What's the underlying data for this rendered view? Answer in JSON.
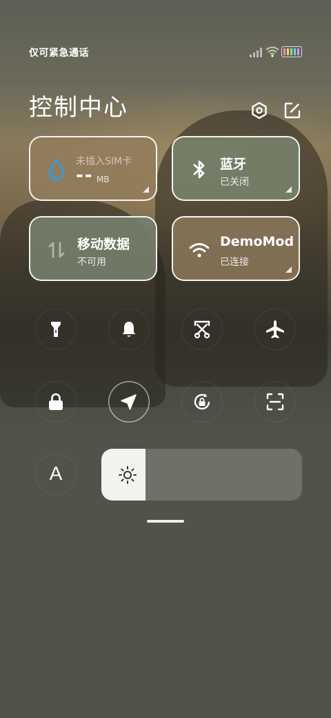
{
  "status_bar": {
    "carrier": "仅可紧急通话"
  },
  "header": {
    "title": "控制中心"
  },
  "tiles": {
    "data_usage": {
      "title": "未插入SIM卡",
      "value": "--",
      "unit": "MB"
    },
    "bluetooth": {
      "title": "蓝牙",
      "status": "已关闭"
    },
    "mobile_data": {
      "title": "移动数据",
      "status": "不可用"
    },
    "wifi": {
      "title": "DemoMod",
      "status": "已连接"
    }
  },
  "auto_brightness": {
    "label": "A"
  },
  "brightness": {
    "level": 0.22
  },
  "colors": {
    "tile_brown": "#8f7c5f",
    "tile_green": "#76806a",
    "water_icon_blue": "#3a9ad9"
  }
}
